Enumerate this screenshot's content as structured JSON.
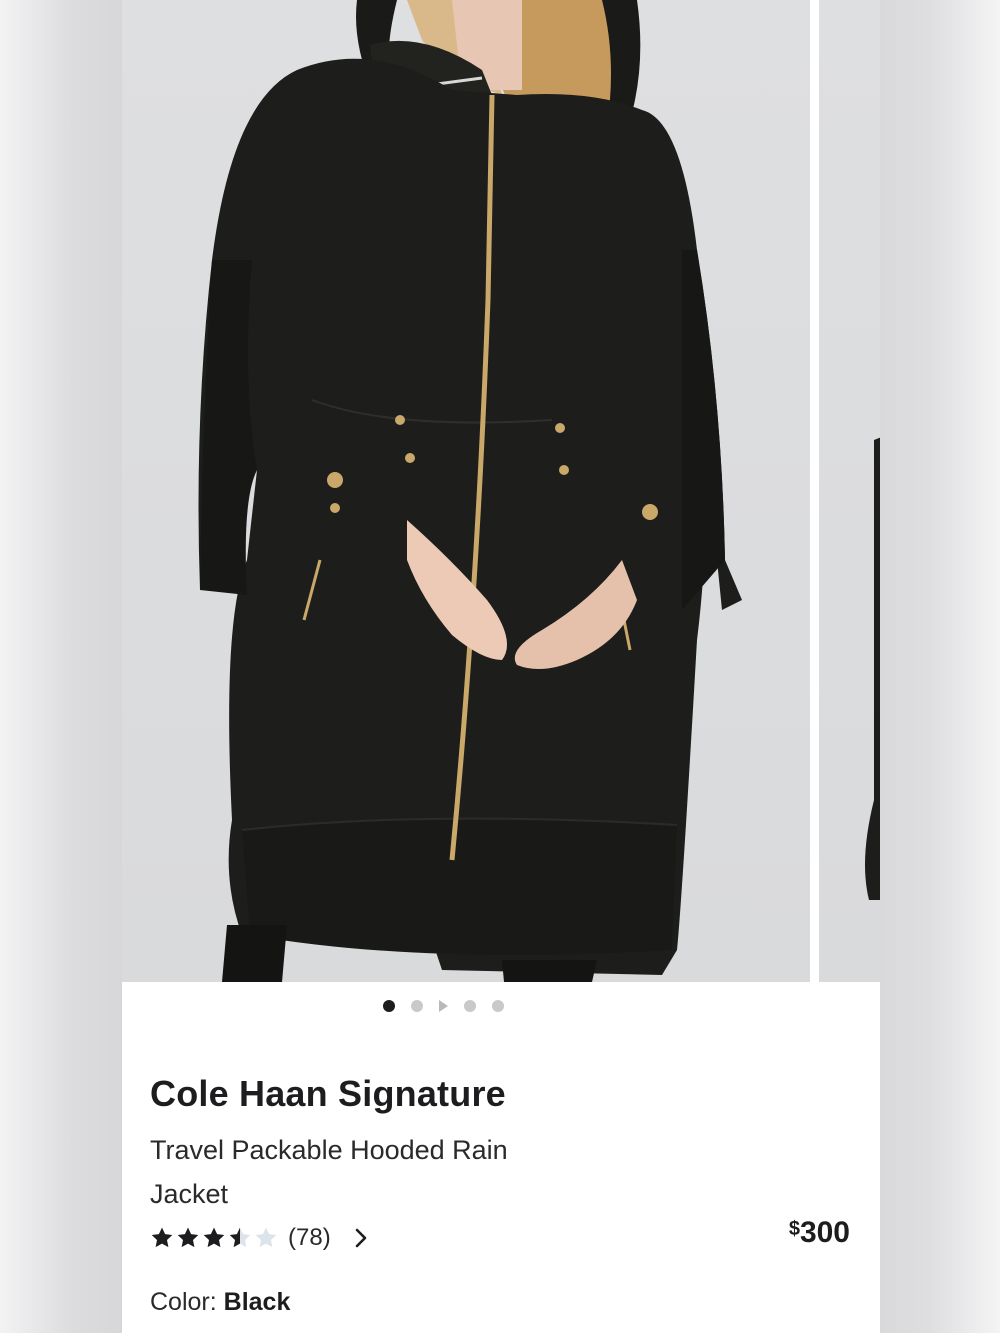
{
  "carousel": {
    "slides": [
      {
        "image": "model-wearing-black-hooded-rain-jacket"
      },
      {
        "image": "second-view-rain-jacket"
      }
    ],
    "indicators": [
      "dot-active",
      "dot",
      "video-play",
      "dot",
      "dot"
    ]
  },
  "product": {
    "brand": "Cole Haan Signature",
    "name": "Travel Packable Hooded Rain Jacket",
    "rating": 3.5,
    "rating_max": 5,
    "review_count": "(78)",
    "price_currency": "$",
    "price_amount": "300",
    "color_label": "Color:",
    "color_value": "Black"
  },
  "colors": {
    "jacket": "#1d1e1b",
    "zipper": "#c9a86a",
    "text": "#1d1d1f"
  }
}
